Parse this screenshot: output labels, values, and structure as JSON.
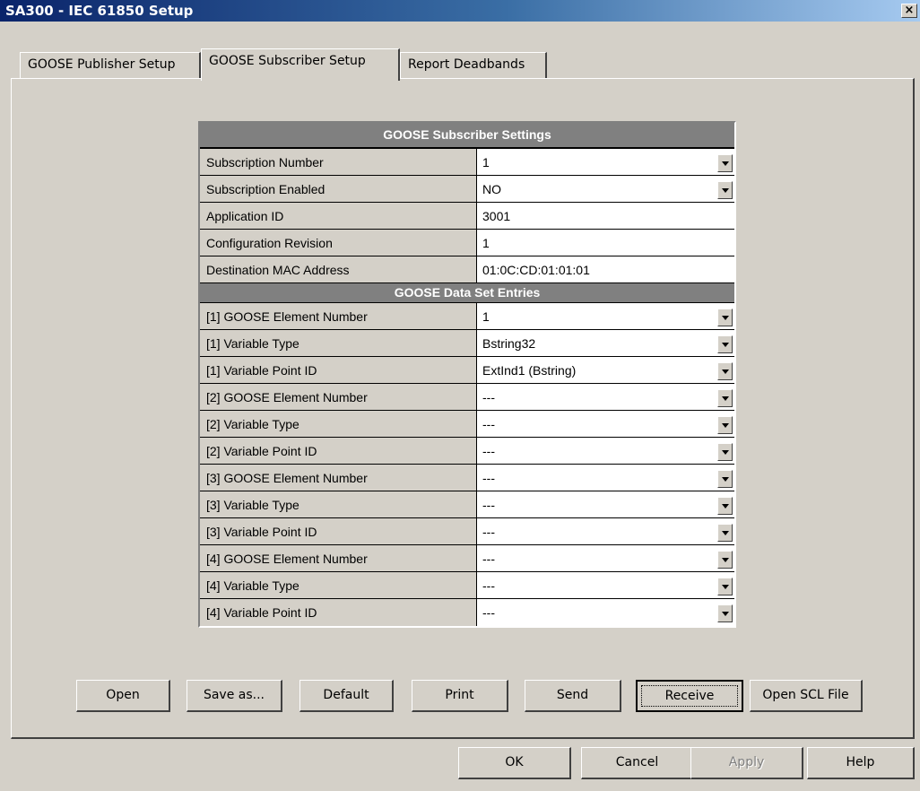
{
  "window": {
    "title": "SA300 - IEC 61850 Setup",
    "close_glyph": "×"
  },
  "tabs": [
    {
      "label": "GOOSE Publisher Setup",
      "active": false
    },
    {
      "label": "GOOSE Subscriber Setup",
      "active": true
    },
    {
      "label": "Report Deadbands",
      "active": false
    }
  ],
  "settings": {
    "header": "GOOSE Subscriber Settings",
    "rows": [
      {
        "label": "Subscription Number",
        "value": "1",
        "dropdown": true
      },
      {
        "label": "Subscription Enabled",
        "value": "NO",
        "dropdown": true
      },
      {
        "label": "Application ID",
        "value": "3001",
        "dropdown": false
      },
      {
        "label": "Configuration Revision",
        "value": "1",
        "dropdown": false
      },
      {
        "label": "Destination MAC Address",
        "value": "01:0C:CD:01:01:01",
        "dropdown": false
      }
    ]
  },
  "dataset": {
    "header": "GOOSE Data Set Entries",
    "rows": [
      {
        "label": "[1] GOOSE Element Number",
        "value": "1"
      },
      {
        "label": "[1] Variable Type",
        "value": "Bstring32"
      },
      {
        "label": "[1] Variable Point ID",
        "value": "ExtInd1 (Bstring)"
      },
      {
        "label": "[2] GOOSE Element Number",
        "value": "---"
      },
      {
        "label": "[2] Variable Type",
        "value": "---"
      },
      {
        "label": "[2] Variable Point ID",
        "value": "---"
      },
      {
        "label": "[3] GOOSE Element Number",
        "value": "---"
      },
      {
        "label": "[3] Variable Type",
        "value": "---"
      },
      {
        "label": "[3] Variable Point ID",
        "value": "---"
      },
      {
        "label": "[4] GOOSE Element Number",
        "value": "---"
      },
      {
        "label": "[4] Variable Type",
        "value": "---"
      },
      {
        "label": "[4] Variable Point ID",
        "value": "---"
      }
    ]
  },
  "actions": {
    "open": "Open",
    "save_as": "Save as...",
    "default": "Default",
    "print": "Print",
    "send": "Send",
    "receive": "Receive",
    "open_scl": "Open SCL File"
  },
  "dialog": {
    "ok": "OK",
    "cancel": "Cancel",
    "apply": "Apply",
    "help": "Help"
  },
  "colors": {
    "title_start": "#0a246a",
    "title_end": "#a6caf0",
    "face": "#d4d0c8",
    "header": "#808080"
  }
}
